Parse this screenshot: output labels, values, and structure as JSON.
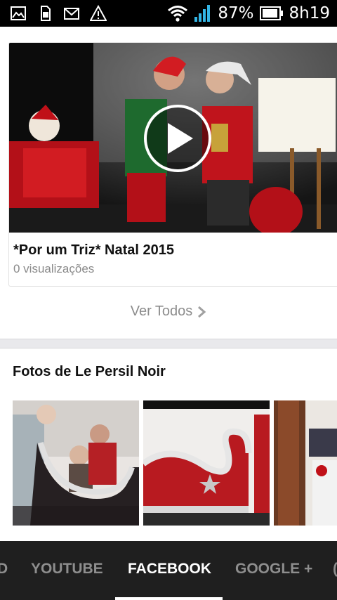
{
  "status_bar": {
    "battery_percent": "87%",
    "time": "8h19",
    "notification_icons": [
      "image-icon",
      "sim-card-icon",
      "gmail-icon",
      "warning-icon"
    ],
    "system_icons": [
      "wifi-icon",
      "signal-icon",
      "battery-icon"
    ]
  },
  "video": {
    "title": "*Por um Triz* Natal 2015",
    "views": "0 visualizações"
  },
  "see_all": {
    "label": "Ver Todos"
  },
  "photos": {
    "title": "Fotos de Le Persil Noir"
  },
  "tabs": [
    {
      "label": "D"
    },
    {
      "label": "YOUTUBE"
    },
    {
      "label": "FACEBOOK",
      "active": true
    },
    {
      "label": "GOOGLE +"
    },
    {
      "label": "("
    }
  ],
  "colors": {
    "tab_bar_bg": "#1f1f1f",
    "tab_active": "#ffffff",
    "tab_inactive": "#8e8e8e",
    "wifi_signal_blue": "#33b5e5"
  }
}
